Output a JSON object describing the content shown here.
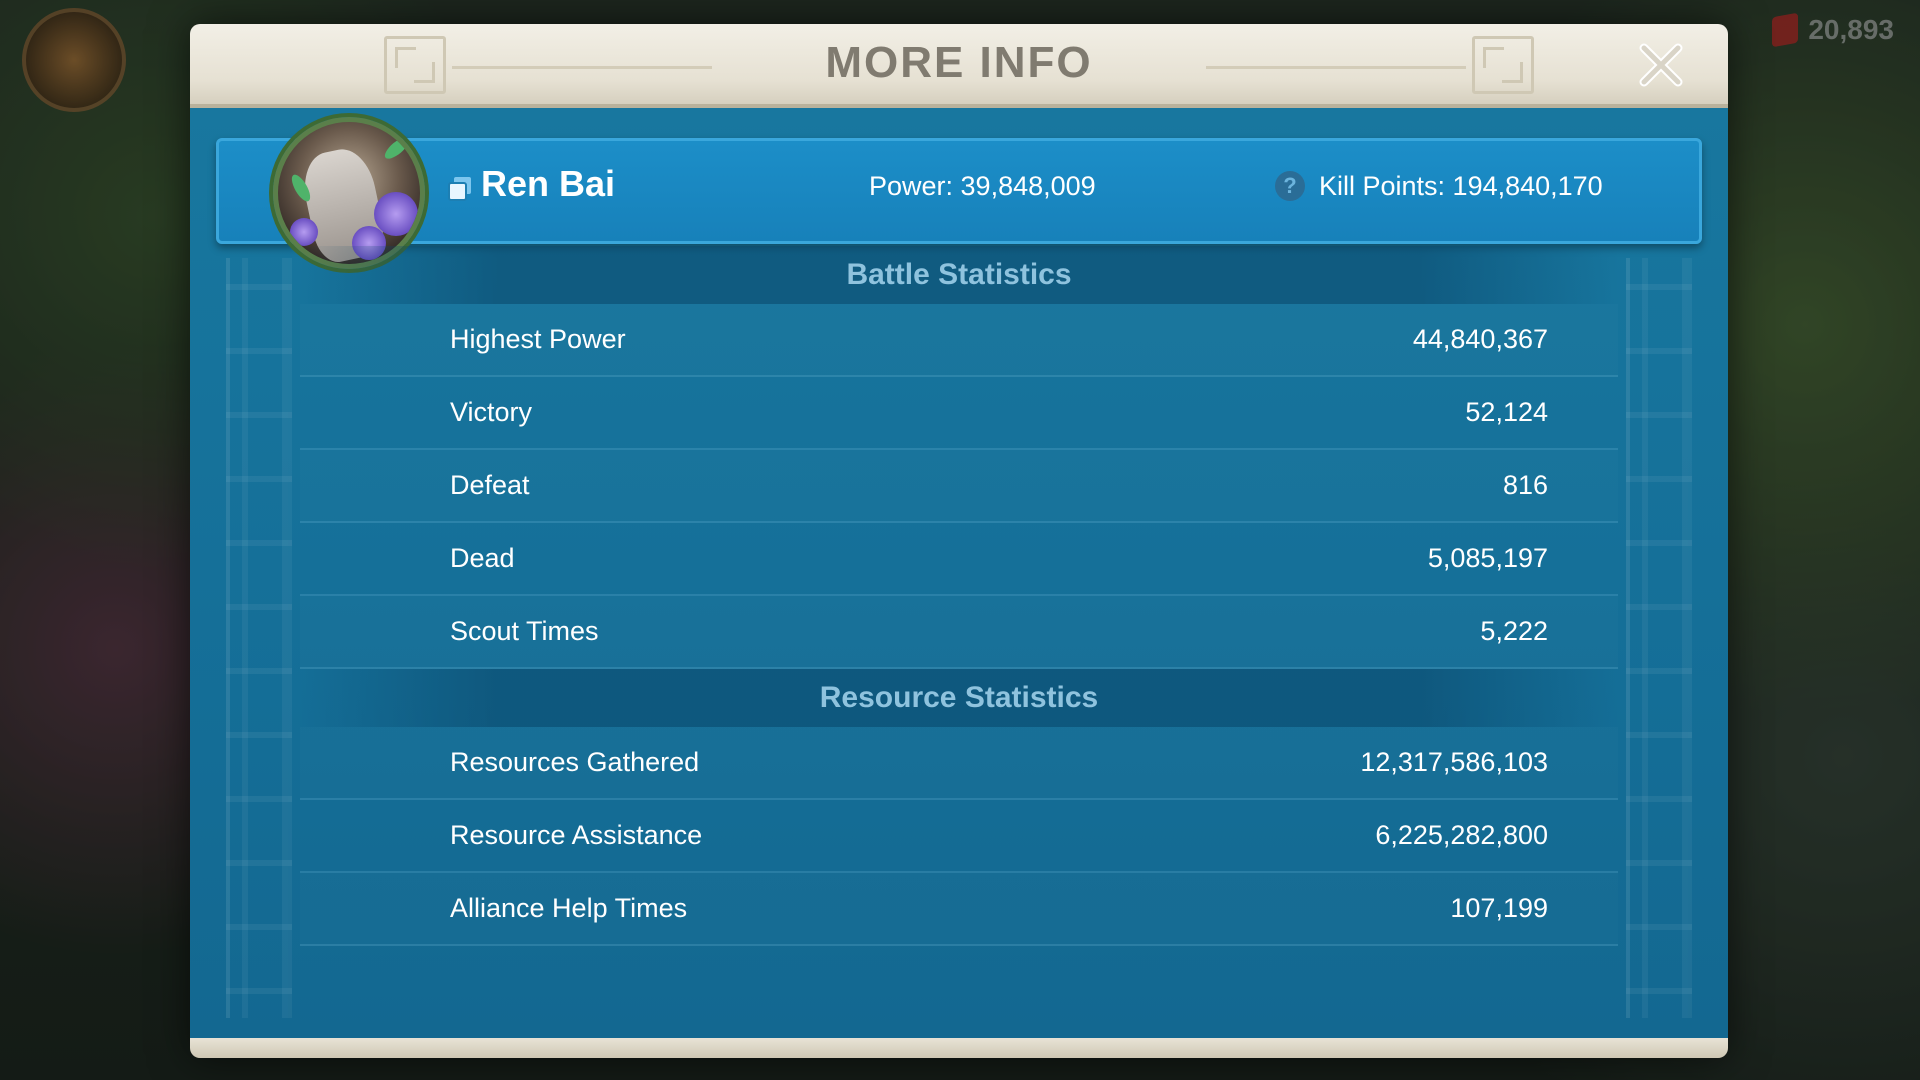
{
  "background": {
    "gem_count": "20,893"
  },
  "modal": {
    "title": "MORE INFO"
  },
  "player": {
    "name": "Ren Bai",
    "power": "Power: 39,848,009",
    "kill_points": "Kill Points: 194,840,170",
    "help_glyph": "?"
  },
  "battle": {
    "header": "Battle Statistics",
    "rows": [
      {
        "label": "Highest Power",
        "value": "44,840,367"
      },
      {
        "label": "Victory",
        "value": "52,124"
      },
      {
        "label": "Defeat",
        "value": "816"
      },
      {
        "label": "Dead",
        "value": "5,085,197"
      },
      {
        "label": "Scout Times",
        "value": "5,222"
      }
    ]
  },
  "resource": {
    "header": "Resource Statistics",
    "rows": [
      {
        "label": "Resources Gathered",
        "value": "12,317,586,103"
      },
      {
        "label": "Resource Assistance",
        "value": "6,225,282,800"
      },
      {
        "label": "Alliance Help Times",
        "value": "107,199"
      }
    ]
  },
  "colors": {
    "panel_blue": "#1680b3",
    "header_parchment": "#ebe6d8",
    "section_header_text": "#8fc3de"
  },
  "icons": [
    "close-icon",
    "alliance-icon",
    "help-icon",
    "avatar"
  ]
}
